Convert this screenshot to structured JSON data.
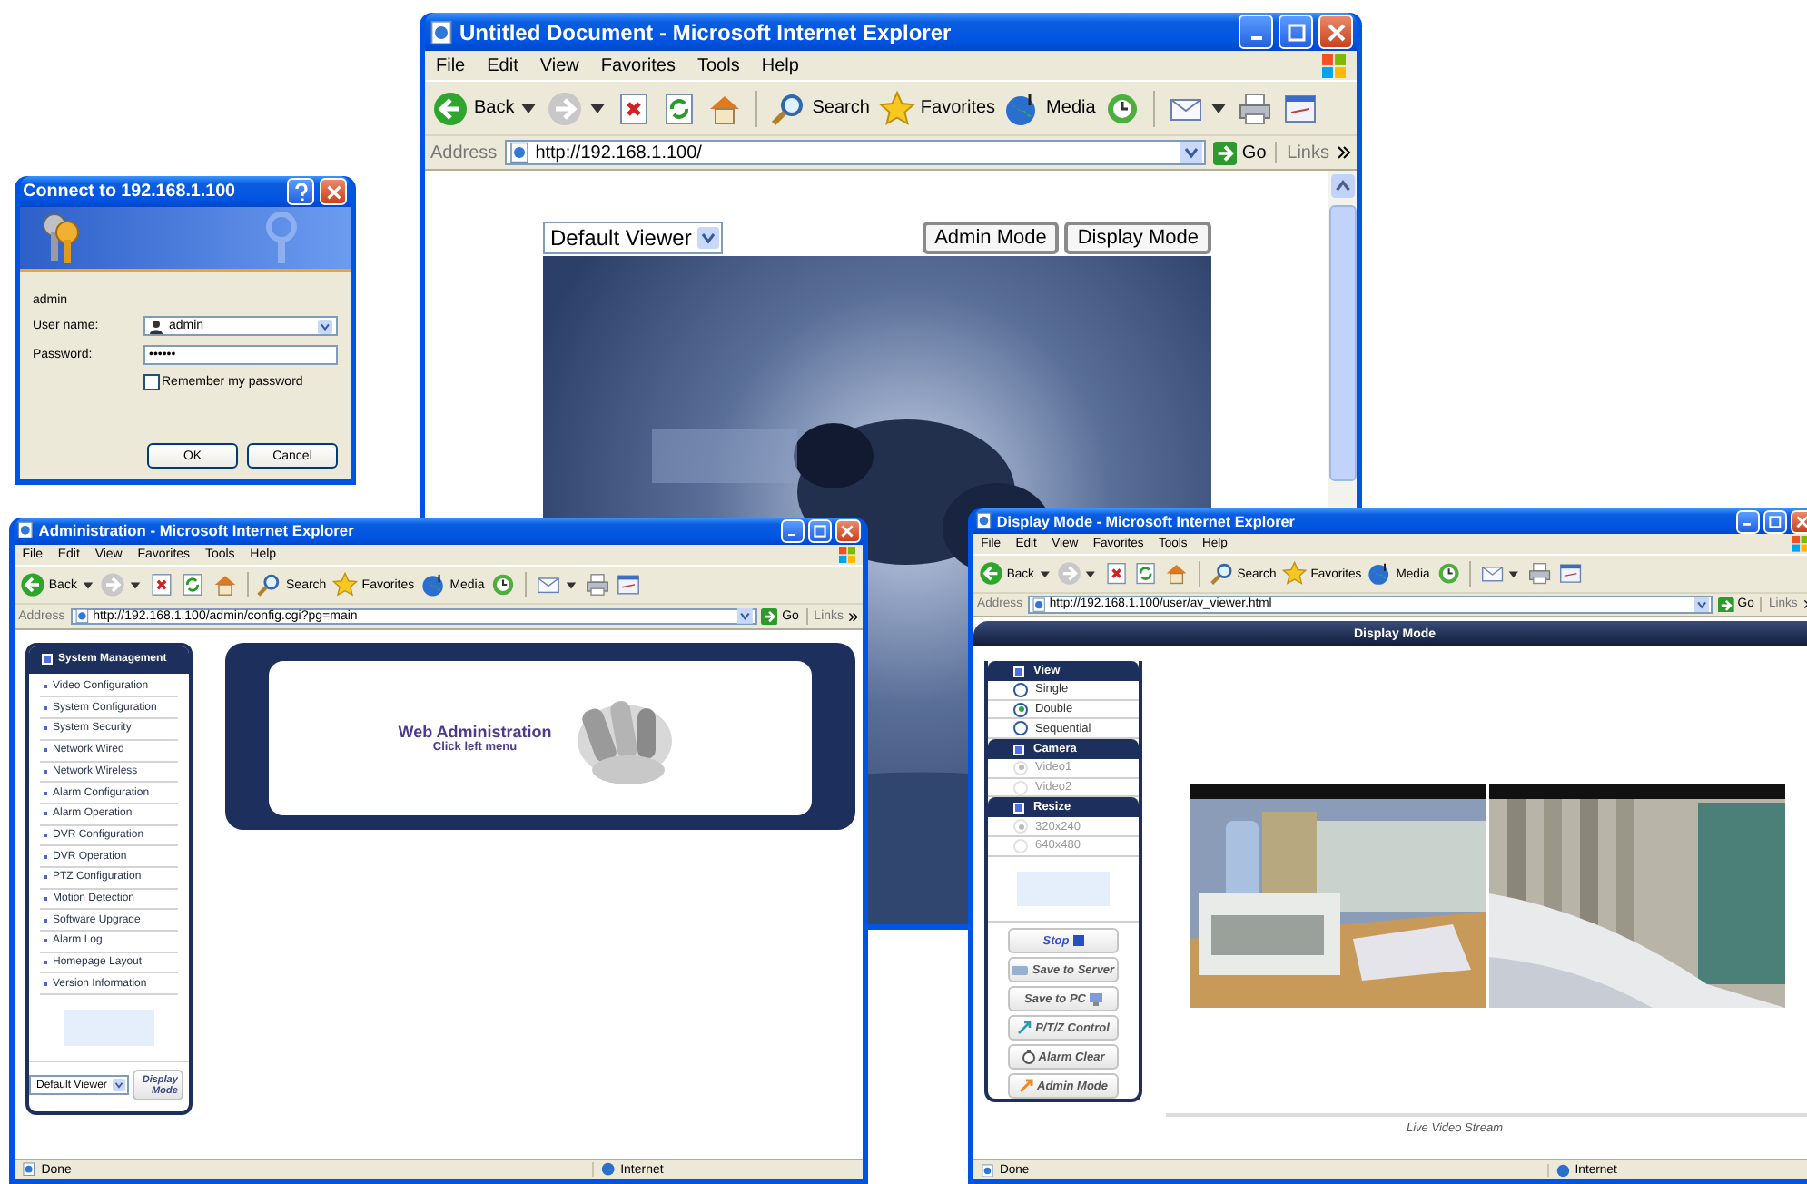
{
  "viewer_window": {
    "browser": {
      "title": "Untitled Document - Microsoft Internet Explorer",
      "menu": [
        "File",
        "Edit",
        "View",
        "Favorites",
        "Tools",
        "Help"
      ],
      "toolbar": [
        {
          "kind": "back",
          "label": "Back"
        },
        {
          "kind": "forward"
        },
        {
          "kind": "stop"
        },
        {
          "kind": "refresh"
        },
        {
          "kind": "home"
        },
        {
          "kind": "search",
          "label": "Search"
        },
        {
          "kind": "favorites",
          "label": "Favorites"
        },
        {
          "kind": "media",
          "label": "Media"
        },
        {
          "kind": "history"
        },
        {
          "kind": "mail"
        },
        {
          "kind": "print"
        },
        {
          "kind": "edit"
        }
      ],
      "address_label": "Address",
      "url": "http://192.168.1.100/",
      "go": "Go",
      "links": "Links"
    },
    "viewer_select": "Default Viewer",
    "buttons": [
      "Admin Mode",
      "Display Mode"
    ]
  },
  "login_dialog": {
    "title": "Connect to 192.168.1.100",
    "realm": "admin",
    "fields": [
      {
        "label": "User name:",
        "value": "admin"
      },
      {
        "label": "Password:",
        "value": "••••••"
      }
    ],
    "remember": {
      "label": "Remember my password",
      "checked": false
    },
    "buttons": [
      "OK",
      "Cancel"
    ]
  },
  "admin_window": {
    "browser": {
      "title": "Administration - Microsoft Internet Explorer",
      "menu": [
        "File",
        "Edit",
        "View",
        "Favorites",
        "Tools",
        "Help"
      ],
      "toolbar": [
        {
          "kind": "back",
          "label": "Back"
        },
        {
          "kind": "forward"
        },
        {
          "kind": "stop"
        },
        {
          "kind": "refresh"
        },
        {
          "kind": "home"
        },
        {
          "kind": "search",
          "label": "Search"
        },
        {
          "kind": "favorites",
          "label": "Favorites"
        },
        {
          "kind": "media",
          "label": "Media"
        },
        {
          "kind": "history"
        },
        {
          "kind": "mail"
        },
        {
          "kind": "print"
        },
        {
          "kind": "edit"
        }
      ],
      "address_label": "Address",
      "url": "http://192.168.1.100/admin/config.cgi?pg=main",
      "go": "Go",
      "links": "Links",
      "status": [
        "Done",
        "Internet"
      ]
    },
    "sidebar": {
      "header": "System Management",
      "items": [
        "Video Configuration",
        "System Configuration",
        "System Security",
        "Network Wired",
        "Network Wireless",
        "Alarm Configuration",
        "Alarm Operation",
        "DVR Configuration",
        "DVR Operation",
        "PTZ Configuration",
        "Motion Detection",
        "Software Upgrade",
        "Alarm Log",
        "Homepage Layout",
        "Version Information"
      ],
      "viewer_select": "Default Viewer",
      "mode_button": "Display Mode"
    },
    "main": {
      "title": "Web Administration",
      "subtitle": "Click left menu"
    }
  },
  "display_window": {
    "browser": {
      "title": "Display Mode - Microsoft Internet Explorer",
      "menu": [
        "File",
        "Edit",
        "View",
        "Favorites",
        "Tools",
        "Help"
      ],
      "toolbar": [
        {
          "kind": "back",
          "label": "Back"
        },
        {
          "kind": "forward"
        },
        {
          "kind": "stop"
        },
        {
          "kind": "refresh"
        },
        {
          "kind": "home"
        },
        {
          "kind": "search",
          "label": "Search"
        },
        {
          "kind": "favorites",
          "label": "Favorites"
        },
        {
          "kind": "media",
          "label": "Media"
        },
        {
          "kind": "history"
        },
        {
          "kind": "mail"
        },
        {
          "kind": "print"
        },
        {
          "kind": "edit"
        }
      ],
      "address_label": "Address",
      "url": "http://192.168.1.100/user/av_viewer.html",
      "go": "Go",
      "links": "Links",
      "status": [
        "Done",
        "Internet"
      ]
    },
    "header": "Display Mode",
    "groups": [
      {
        "title": "View",
        "disabled": false,
        "options": [
          {
            "label": "Single",
            "selected": false
          },
          {
            "label": "Double",
            "selected": true
          },
          {
            "label": "Sequential",
            "selected": false
          }
        ]
      },
      {
        "title": "Camera",
        "disabled": true,
        "options": [
          {
            "label": "Video1",
            "selected": true
          },
          {
            "label": "Video2",
            "selected": false
          }
        ]
      },
      {
        "title": "Resize",
        "disabled": true,
        "options": [
          {
            "label": "320x240",
            "selected": true
          },
          {
            "label": "640x480",
            "selected": false
          }
        ]
      }
    ],
    "buttons": [
      {
        "kind": "stop",
        "label": "Stop"
      },
      {
        "kind": "save_server",
        "label": "Save to Server"
      },
      {
        "kind": "save_pc",
        "label": "Save to PC"
      },
      {
        "kind": "ptz",
        "label": "P/T/Z Control"
      },
      {
        "kind": "alarm",
        "label": "Alarm Clear"
      },
      {
        "kind": "admin",
        "label": "Admin Mode"
      }
    ],
    "caption": "Live Video Stream"
  }
}
